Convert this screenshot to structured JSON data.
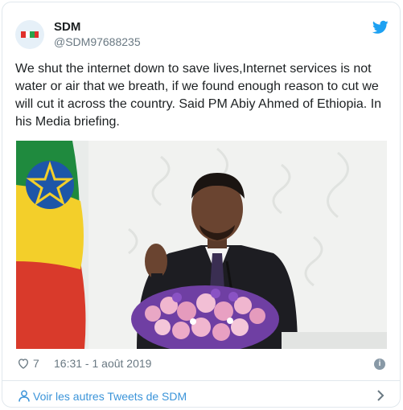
{
  "author": {
    "name": "SDM",
    "handle": "@SDM97688235"
  },
  "tweet": {
    "text": "We shut the internet down to save lives,Internet services is not water or air that we breath, if we found enough reason to cut we will cut it across the country. Said PM Abiy Ahmed of Ethiopia. In his Media briefing.",
    "likes": "7",
    "timestamp": "16:31 - 1 août 2019"
  },
  "footer": {
    "more_tweets_label": "Voir les autres Tweets de SDM"
  },
  "icons": {
    "brand": "twitter-bird-icon",
    "like": "heart-icon",
    "info": "info-icon",
    "profile": "person-icon",
    "chevron": "chevron-right-icon"
  },
  "colors": {
    "link": "#3b94d9",
    "twitter_blue": "#1da1f2",
    "muted": "#697882",
    "border": "#e1e8ed"
  }
}
